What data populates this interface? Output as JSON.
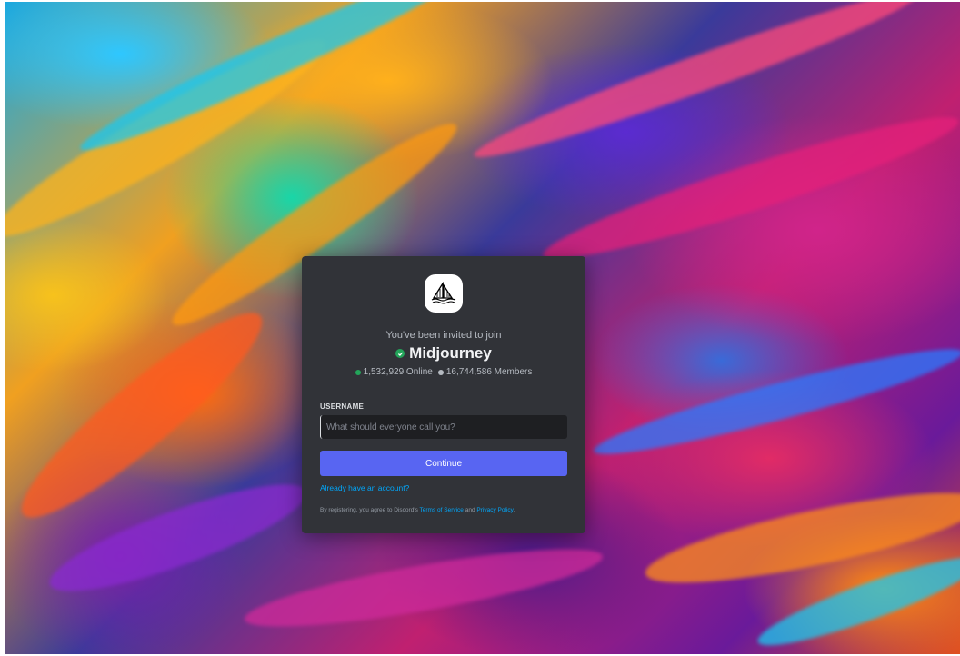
{
  "invite": {
    "invited_text": "You've been invited to join",
    "server_name": "Midjourney",
    "online_count": "1,532,929 Online",
    "member_count": "16,744,586 Members",
    "online_color": "#23a55a",
    "members_color": "#b5bac1",
    "logo_icon": "sailboat-icon",
    "verified_icon": "verified-check-icon"
  },
  "form": {
    "username_label": "USERNAME",
    "username_placeholder": "What should everyone call you?",
    "username_value": "",
    "continue_label": "Continue",
    "already_account_link": "Already have an account?",
    "terms_prefix": "By registering, you agree to Discord's ",
    "terms_link": "Terms of Service",
    "terms_and": " and ",
    "privacy_link": "Privacy Policy",
    "terms_suffix": "."
  },
  "colors": {
    "accent": "#5865f2",
    "link": "#00a8fc",
    "card_bg": "#313338"
  }
}
